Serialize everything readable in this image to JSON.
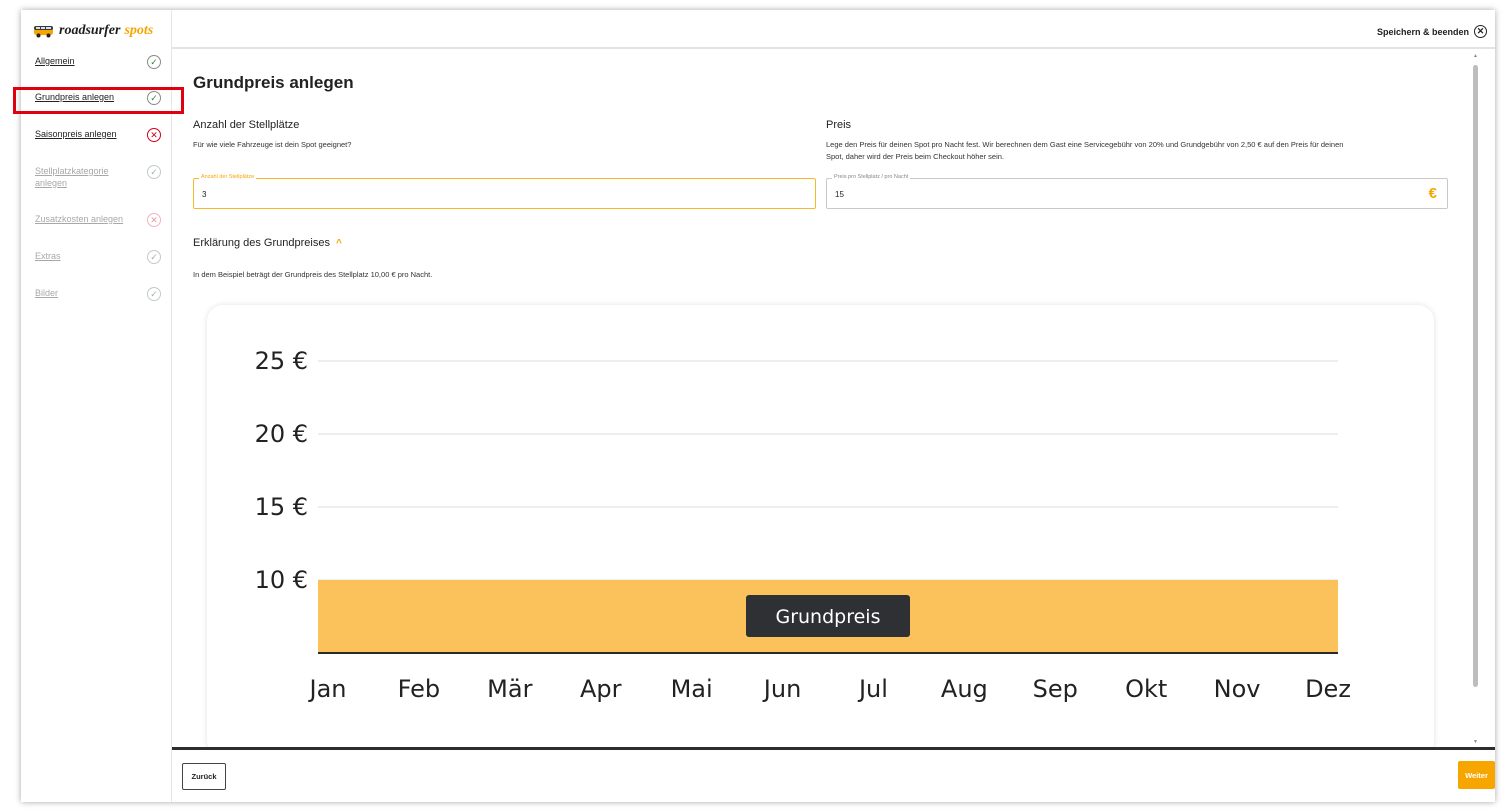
{
  "brand": {
    "name": "roadsurfer",
    "suffix": "spots",
    "accent": "#f7a600"
  },
  "sidebar": {
    "items": [
      {
        "label": "Allgemein",
        "status": "ok",
        "muted": false
      },
      {
        "label": "Grundpreis anlegen",
        "status": "ok",
        "muted": false,
        "highlighted": true
      },
      {
        "label": "Saisonpreis anlegen",
        "status": "error",
        "muted": false
      },
      {
        "label": "Stellplatzkategorie anlegen",
        "status": "ok",
        "muted": true
      },
      {
        "label": "Zusatzkosten anlegen",
        "status": "error",
        "muted": true
      },
      {
        "label": "Extras",
        "status": "ok",
        "muted": true
      },
      {
        "label": "Bilder",
        "status": "ok",
        "muted": true
      }
    ]
  },
  "header": {
    "save_exit_label": "Speichern & beenden"
  },
  "main": {
    "title": "Grundpreis anlegen",
    "spots": {
      "heading": "Anzahl der Stellplätze",
      "description": "Für wie viele Fahrzeuge ist dein Spot geeignet?",
      "field_label": "Anzahl der Stellplätze",
      "field_value": "3"
    },
    "price": {
      "heading": "Preis",
      "description_line1": "Lege den Preis für deinen Spot pro Nacht fest. Wir berechnen dem Gast eine Servicegebühr von 20% und Grundgebühr von 2,50 € auf den Preis für deinen",
      "description_line2": "Spot, daher wird der Preis beim Checkout höher sein.",
      "field_label": "Preis pro Stellplatz / pro Nacht",
      "field_value": "15",
      "currency_symbol": "€"
    },
    "explanation": {
      "heading": "Erklärung des Grundpreises",
      "text": "In dem Beispiel beträgt der Grundpreis des Stellplatz 10,00 € pro Nacht."
    }
  },
  "chart_data": {
    "type": "area",
    "categories": [
      "Jan",
      "Feb",
      "Mär",
      "Apr",
      "Mai",
      "Jun",
      "Jul",
      "Aug",
      "Sep",
      "Okt",
      "Nov",
      "Dez"
    ],
    "series": [
      {
        "name": "Grundpreis",
        "values": [
          10,
          10,
          10,
          10,
          10,
          10,
          10,
          10,
          10,
          10,
          10,
          10
        ],
        "color": "#fbc15a"
      }
    ],
    "y_ticks": [
      {
        "value": 25,
        "label": "25 €"
      },
      {
        "value": 20,
        "label": "20 €"
      },
      {
        "value": 15,
        "label": "15 €"
      },
      {
        "value": 10,
        "label": "10 €"
      }
    ],
    "ylim": [
      5,
      25
    ],
    "grid": true,
    "label_box": {
      "text": "Grundpreis",
      "color": "#2e3033"
    }
  },
  "footer": {
    "back_label": "Zurück",
    "next_label": "Weiter"
  }
}
